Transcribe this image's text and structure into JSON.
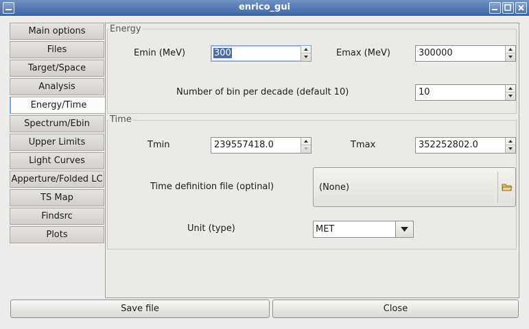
{
  "window": {
    "title": "enrico_gui"
  },
  "tabs": [
    {
      "label": "Main options"
    },
    {
      "label": "Files"
    },
    {
      "label": "Target/Space"
    },
    {
      "label": "Analysis"
    },
    {
      "label": "Energy/Time",
      "active": true
    },
    {
      "label": "Spectrum/Ebin"
    },
    {
      "label": "Upper Limits"
    },
    {
      "label": "Light Curves"
    },
    {
      "label": "Apperture/Folded LC"
    },
    {
      "label": "TS Map"
    },
    {
      "label": "Findsrc"
    },
    {
      "label": "Plots"
    }
  ],
  "energy": {
    "title": "Energy",
    "emin_label": "Emin (MeV)",
    "emin_value": "300",
    "emax_label": "Emax (MeV)",
    "emax_value": "300000",
    "nbin_label": "Number of bin per decade (default 10)",
    "nbin_value": "10"
  },
  "time": {
    "title": "Time",
    "tmin_label": "Tmin",
    "tmin_value": "239557418.0",
    "tmax_label": "Tmax",
    "tmax_value": "352252802.0",
    "timedef_label": "Time definition file (optinal)",
    "timedef_value": "(None)",
    "unit_label": "Unit (type)",
    "unit_value": "MET"
  },
  "buttons": {
    "save": "Save file",
    "close": "Close"
  }
}
